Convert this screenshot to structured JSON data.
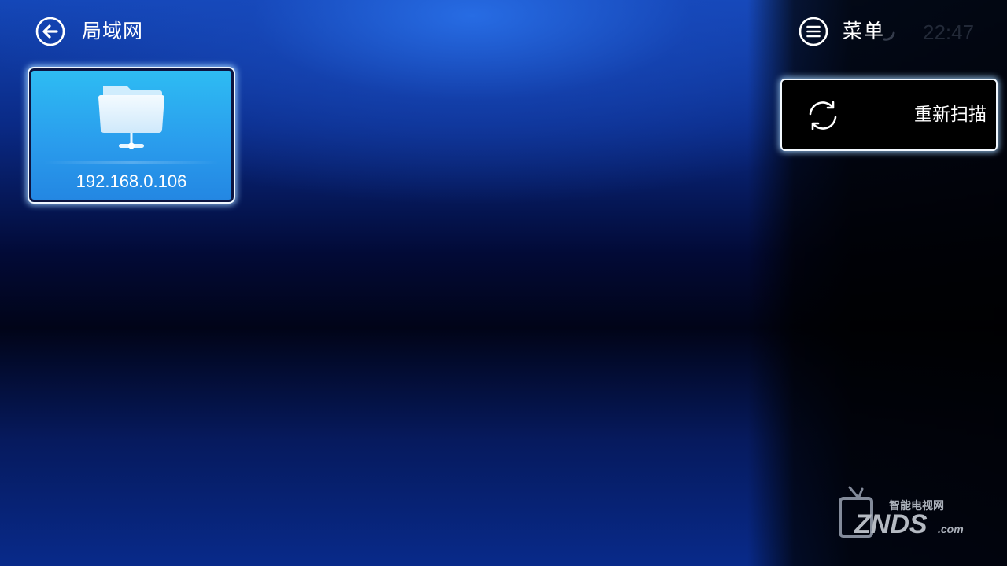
{
  "header": {
    "back_icon": "back-arrow-icon",
    "title": "局域网",
    "menu_icon": "menu-icon",
    "menu_label": "菜单",
    "clock": "22:47"
  },
  "devices": [
    {
      "icon": "network-folder-icon",
      "label": "192.168.0.106"
    }
  ],
  "menu_panel": {
    "items": [
      {
        "icon": "refresh-icon",
        "label": "重新扫描"
      }
    ]
  },
  "watermark": {
    "top_text": "智能电视网",
    "brand": "ZNDS",
    "suffix": ".com"
  },
  "colors": {
    "tile_blue": "#2a9ded",
    "focus_border": "#eef6ff",
    "panel_bg": "#000000"
  }
}
